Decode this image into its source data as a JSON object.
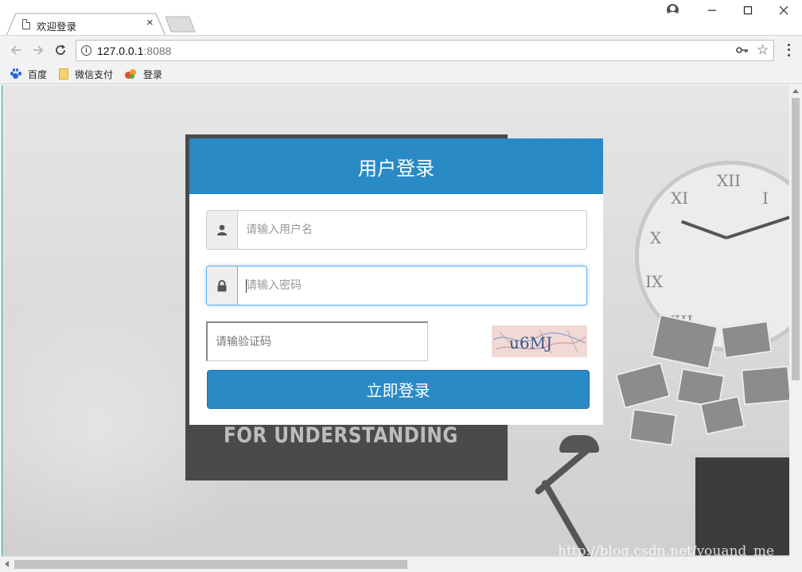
{
  "browser": {
    "tab_title": "欢迎登录",
    "tab_close": "×",
    "url_host": "127.0.0.1",
    "url_port": ":8088",
    "icons": {
      "back": "back-arrow-icon",
      "forward": "forward-arrow-icon",
      "reload": "reload-icon",
      "info": "info-icon",
      "key": "key-icon",
      "star": "bookmark-star-icon",
      "menu": "menu-dots-icon",
      "profile": "profile-icon"
    },
    "bookmarks": [
      {
        "label": "百度",
        "icon": "baidu-paw-icon"
      },
      {
        "label": "微信支付",
        "icon": "folder-icon"
      },
      {
        "label": "登录",
        "icon": "leaf-icon"
      }
    ]
  },
  "login": {
    "title": "用户登录",
    "username_placeholder": "请输入用户名",
    "password_placeholder": "请输入密码",
    "captcha_placeholder": "请输验证码",
    "captcha_text": "u6MJ",
    "submit_label": "立即登录"
  },
  "background": {
    "poster_text": "FOR UNDERSTANDING",
    "watermark": "http://blog.csdn.net/youand_me"
  },
  "colors": {
    "accent": "#2a8ac6",
    "focus_border": "#66afe9",
    "captcha_bg": "#f1d9d6"
  }
}
